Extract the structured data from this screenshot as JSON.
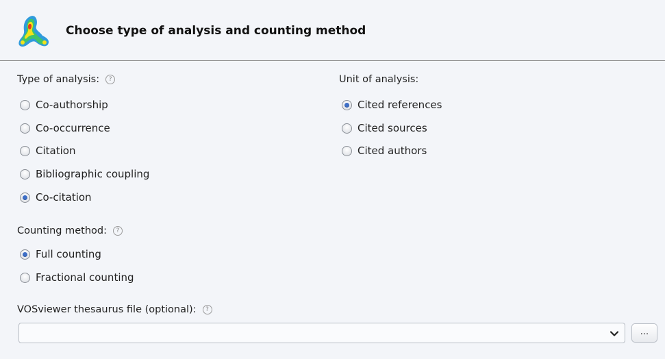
{
  "header": {
    "title": "Choose type of analysis and counting method",
    "logo_icon": "vosviewer-logo-icon"
  },
  "type_of_analysis": {
    "label": "Type of analysis:",
    "help_icon": "?",
    "options": [
      {
        "label": "Co-authorship",
        "checked": false
      },
      {
        "label": "Co-occurrence",
        "checked": false
      },
      {
        "label": "Citation",
        "checked": false
      },
      {
        "label": "Bibliographic coupling",
        "checked": false
      },
      {
        "label": "Co-citation",
        "checked": true
      }
    ]
  },
  "unit_of_analysis": {
    "label": "Unit of analysis:",
    "options": [
      {
        "label": "Cited references",
        "checked": true
      },
      {
        "label": "Cited sources",
        "checked": false
      },
      {
        "label": "Cited authors",
        "checked": false
      }
    ]
  },
  "counting_method": {
    "label": "Counting method:",
    "help_icon": "?",
    "options": [
      {
        "label": "Full counting",
        "checked": true
      },
      {
        "label": "Fractional counting",
        "checked": false
      }
    ]
  },
  "thesaurus": {
    "label": "VOSviewer thesaurus file (optional):",
    "help_icon": "?",
    "value": "",
    "browse_label": "..."
  },
  "colors": {
    "radio_selected": "#3e6fc7",
    "background": "#f3f5f9",
    "divider": "#8c8c8c"
  }
}
